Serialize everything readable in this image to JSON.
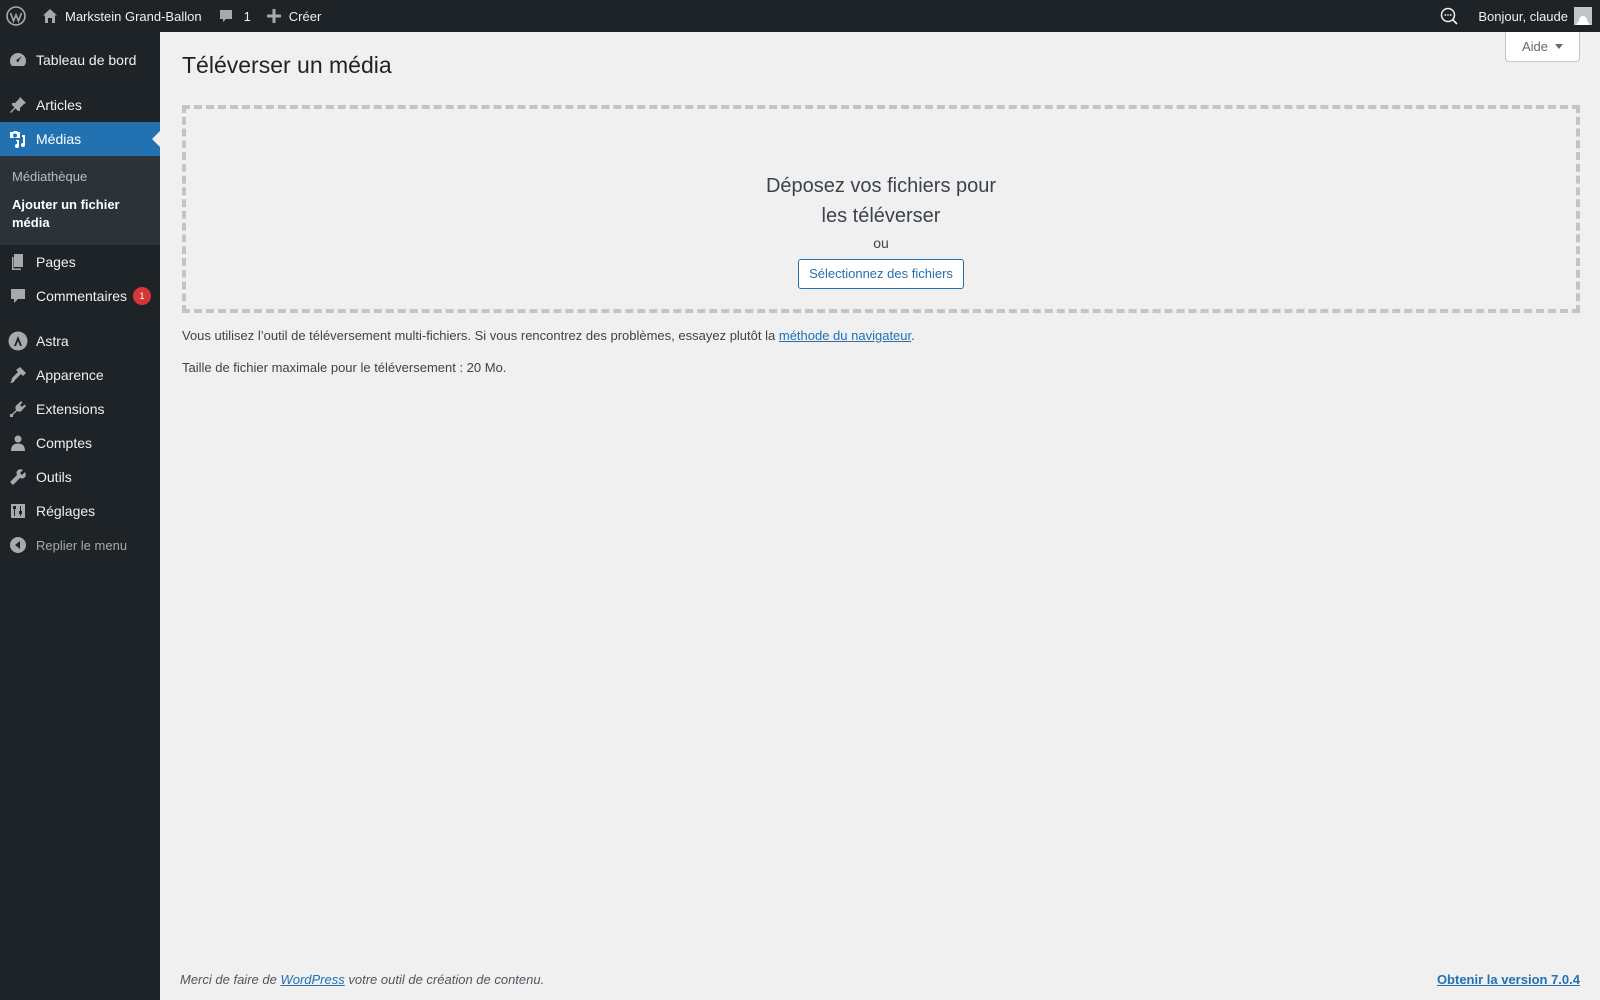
{
  "adminbar": {
    "site_name": "Markstein Grand-Ballon",
    "comments_count": "1",
    "new_label": "Créer",
    "greeting": "Bonjour, claude"
  },
  "sidebar": {
    "items": [
      {
        "label": "Tableau de bord",
        "icon": "dashboard-icon"
      },
      {
        "label": "Articles",
        "icon": "pin-icon"
      },
      {
        "label": "Médias",
        "icon": "media-icon"
      },
      {
        "label": "Pages",
        "icon": "pages-icon"
      },
      {
        "label": "Commentaires",
        "icon": "comment-icon",
        "badge": "1"
      },
      {
        "label": "Astra",
        "icon": "astra-icon"
      },
      {
        "label": "Apparence",
        "icon": "brush-icon"
      },
      {
        "label": "Extensions",
        "icon": "plugin-icon"
      },
      {
        "label": "Comptes",
        "icon": "user-icon"
      },
      {
        "label": "Outils",
        "icon": "wrench-icon"
      },
      {
        "label": "Réglages",
        "icon": "settings-icon"
      }
    ],
    "submenu": [
      "Médiathèque",
      "Ajouter un fichier média"
    ],
    "collapse_label": "Replier le menu"
  },
  "main": {
    "help_label": "Aide",
    "title": "Téléverser un média",
    "drop_title": "Déposez vos fichiers pour les téléverser",
    "drop_or": "ou",
    "select_button": "Sélectionnez des fichiers",
    "info_text": "Vous utilisez l’outil de téléversement multi-fichiers. Si vous rencontrez des problèmes, essayez plutôt la",
    "info_link": "méthode du navigateur",
    "info_end": ".",
    "max_size": "Taille de fichier maximale pour le téléversement : 20 Mo."
  },
  "footer": {
    "thanks_before": "Merci de faire de",
    "thanks_link": "WordPress",
    "thanks_after": "votre outil de création de contenu.",
    "version_link": "Obtenir la version 7.0.4"
  },
  "colors": {
    "adminbar_bg": "#1d2327",
    "accent": "#2271b1",
    "badge": "#d63638",
    "page_bg": "#f0f0f1"
  }
}
